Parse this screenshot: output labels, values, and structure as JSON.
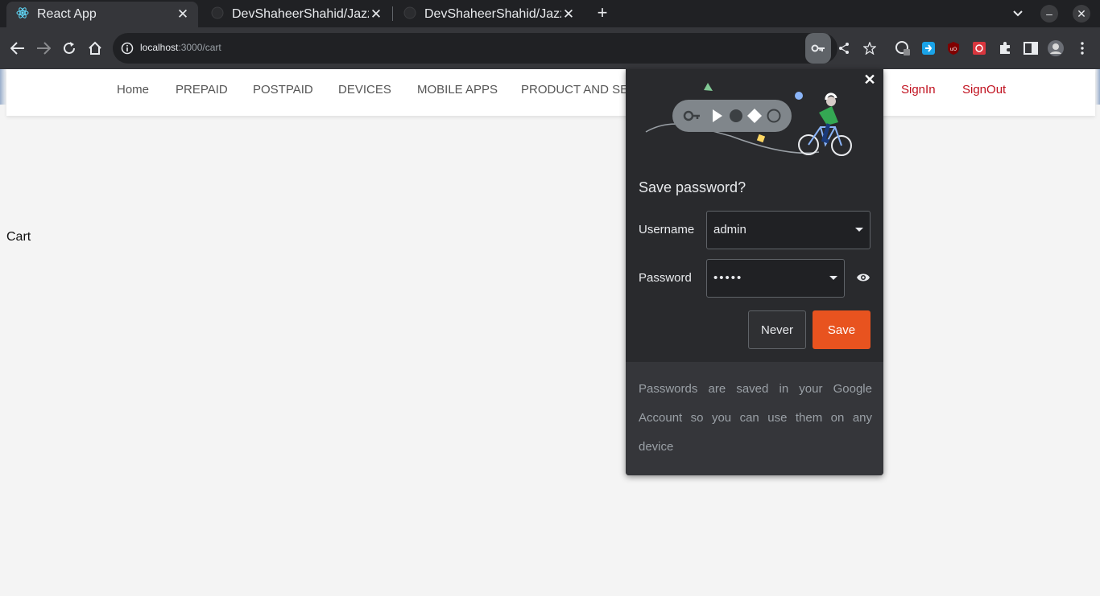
{
  "browser": {
    "tabs": [
      {
        "title": "React App",
        "active": true
      },
      {
        "title": "DevShaheerShahid/Jazza"
      },
      {
        "title": "DevShaheerShahid/Jazza"
      }
    ],
    "url": {
      "host": "localhost",
      "path": ":3000/cart"
    }
  },
  "nav": {
    "home": "Home",
    "prepaid": "PREPAID",
    "postpaid": "POSTPAID",
    "devices": "DEVICES",
    "mobile_apps": "MOBILE APPS",
    "product": "PRODUCT AND SER",
    "signin": "SignIn",
    "signout": "SignOut"
  },
  "page": {
    "heading": "Cart"
  },
  "password_bubble": {
    "title": "Save  password?",
    "username_label": "Username",
    "username_value": "admin",
    "password_label": "Password",
    "password_value": "•••••",
    "never_label": "Never",
    "save_label": "Save",
    "footer": "Passwords are saved in your Google Account so you can use them on any device",
    "accent_color": "#e8531f"
  },
  "colors": {
    "brand_red": "#c0101e"
  }
}
